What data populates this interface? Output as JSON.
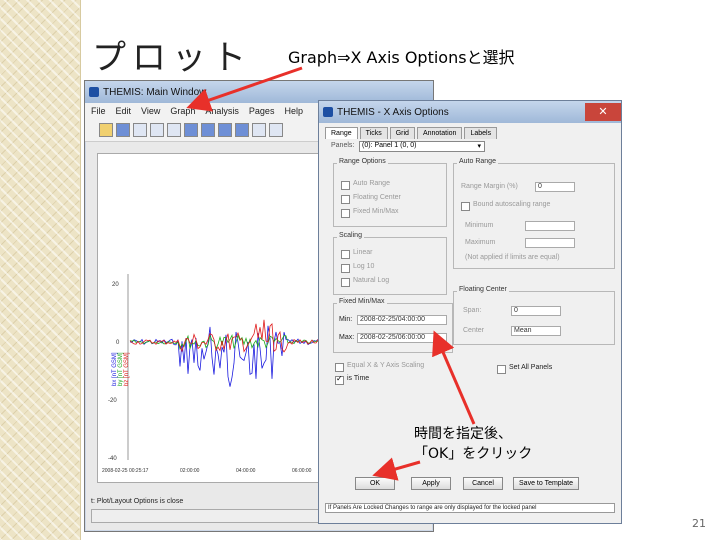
{
  "slide": {
    "title": "プロット",
    "caption": "Graph⇒X Axis Optionsと選択",
    "page_number": "21",
    "annotation_line1": "時間を指定後、",
    "annotation_line2": "「OK」をクリック"
  },
  "main_window": {
    "title": "THEMIS: Main Window",
    "menu": [
      "File",
      "Edit",
      "View",
      "Graph",
      "Analysis",
      "Pages",
      "Help"
    ],
    "y_ticks": [
      "20",
      "0",
      "-20",
      "-40"
    ],
    "legend": [
      "bx [nT GSM]",
      "by [nT GSM]",
      "bz [nT GSM]"
    ],
    "x_ticks": [
      "2008-02-25\n00:25:17",
      "02:00:00",
      "04:00:00",
      "06:00:00"
    ],
    "status": "t: Plot/Layout Options is close"
  },
  "dialog": {
    "title": "THEMIS - X Axis Options",
    "tabs": [
      "Range",
      "Ticks",
      "Grid",
      "Annotation",
      "Labels"
    ],
    "panel_label": "Panels:",
    "panel_value": "(0): Panel 1 (0, 0)",
    "range_options_title": "Range Options",
    "range_options": [
      "Auto Range",
      "Floating Center",
      "Fixed Min/Max"
    ],
    "auto_range_title": "Auto Range",
    "range_margin_label": "Range Margin (%)",
    "range_margin_value": "0",
    "bounding_label": "Bound autoscaling range",
    "minimum_label": "Minimum",
    "maximum_label": "Maximum",
    "bounds_note": "(Not applied if limits are equal)",
    "scaling_title": "Scaling",
    "scaling_options": [
      "Linear",
      "Log 10",
      "Natural Log"
    ],
    "fixed_title": "Fixed Min/Max",
    "min_label": "Min:",
    "min_value": "2008-02-25/04:00:00",
    "max_label": "Max:",
    "max_value": "2008-02-25/06:00:00",
    "floating_title": "Floating Center",
    "span_label": "Span:",
    "span_value": "0",
    "center_label": "Center",
    "center_value": "Mean",
    "equal_label": "Equal X & Y Axis Scaling",
    "set_all_panels": "Set All Panels",
    "is_time_label": "is Time",
    "buttons": [
      "OK",
      "Apply",
      "Cancel",
      "Save to Template"
    ],
    "footer_note": "If Panels Are Locked Changes to range are only displayed for the locked panel"
  },
  "chart_data": {
    "type": "line",
    "series": [
      {
        "name": "bx [nT GSM]",
        "color": "#1a1adf"
      },
      {
        "name": "by [nT GSM]",
        "color": "#1aa81a"
      },
      {
        "name": "bz [nT GSM]",
        "color": "#df1a1a"
      }
    ],
    "ylim": [
      -40,
      20
    ]
  }
}
